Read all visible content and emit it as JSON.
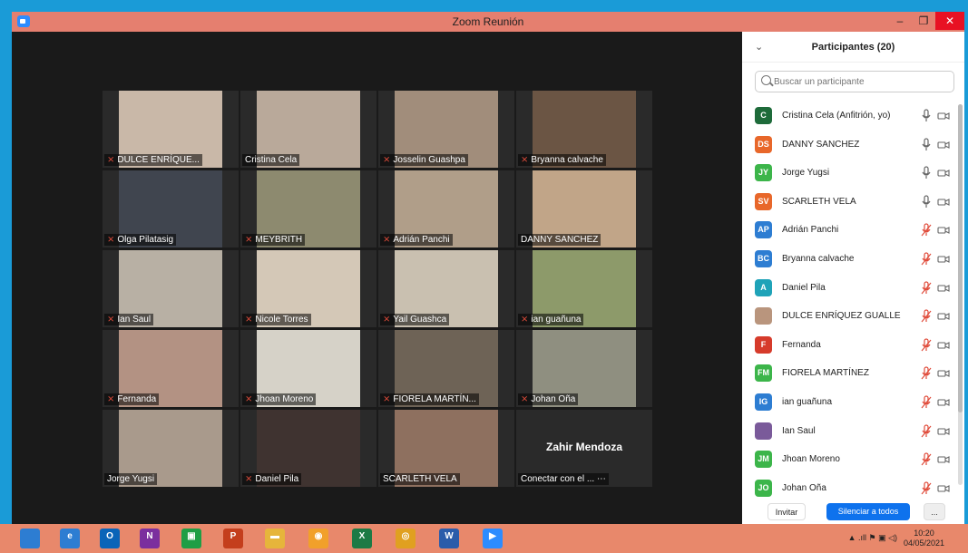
{
  "window": {
    "title": "Zoom Reunión",
    "minimize": "–",
    "maximize": "❐",
    "close": "✕"
  },
  "gallery": {
    "tiles": [
      {
        "name": "DULCE ENRÍQUE...",
        "muted": true,
        "bg": "#c9b8a8"
      },
      {
        "name": "Cristina Cela",
        "muted": false,
        "bg": "#b9a99a"
      },
      {
        "name": "Josselin Guashpa",
        "muted": true,
        "bg": "#a18d7b"
      },
      {
        "name": "Bryanna calvache",
        "muted": true,
        "bg": "#6b5544"
      },
      {
        "name": "Olga Pilatasig",
        "muted": true,
        "bg": "#40454f"
      },
      {
        "name": "MEYBRITH",
        "muted": true,
        "bg": "#8d8a6f"
      },
      {
        "name": "Adrián Panchi",
        "muted": true,
        "bg": "#b09e89"
      },
      {
        "name": "DANNY SANCHEZ",
        "muted": false,
        "bg": "#c1a588"
      },
      {
        "name": "Ian Saul",
        "muted": true,
        "bg": "#b8b0a4"
      },
      {
        "name": "Nicole     Torres",
        "muted": true,
        "bg": "#d4c8b7"
      },
      {
        "name": "Yail Guashca",
        "muted": true,
        "bg": "#c9c0b0"
      },
      {
        "name": "ian guañuna",
        "muted": true,
        "bg": "#8d9a6a"
      },
      {
        "name": "Fernanda",
        "muted": true,
        "bg": "#b39283"
      },
      {
        "name": "Jhoan Moreno",
        "muted": true,
        "bg": "#d6d2c8"
      },
      {
        "name": "FIORELA MARTÍN...",
        "muted": true,
        "bg": "#6e6356"
      },
      {
        "name": "Johan Oña",
        "muted": true,
        "bg": "#8f8f80"
      },
      {
        "name": "Jorge    Yugsi",
        "muted": false,
        "bg": "#a99a8c",
        "active": true
      },
      {
        "name": "Daniel Pila",
        "muted": true,
        "bg": "#3f3330"
      },
      {
        "name": "SCARLETH VELA",
        "muted": false,
        "bg": "#8e705f"
      },
      {
        "name": "Conectar con el ... ⋯",
        "muted": false,
        "bg": "#2a2a2a",
        "big_name": "Zahir Mendoza"
      }
    ]
  },
  "participants_panel": {
    "title": "Participantes (20)",
    "search_placeholder": "Buscar un participante",
    "items": [
      {
        "initials": "C",
        "name": "Cristina Cela (Anfitrión, yo)",
        "color": "#1e6b3a",
        "mic": "on"
      },
      {
        "initials": "DS",
        "name": "DANNY SANCHEZ",
        "color": "#e8672a",
        "mic": "on"
      },
      {
        "initials": "JY",
        "name": "Jorge    Yugsi",
        "color": "#3cb54a",
        "mic": "on"
      },
      {
        "initials": "SV",
        "name": "SCARLETH VELA",
        "color": "#e8672a",
        "mic": "on"
      },
      {
        "initials": "AP",
        "name": "Adrián Panchi",
        "color": "#2d7dd2",
        "mic": "muted"
      },
      {
        "initials": "BC",
        "name": "Bryanna calvache",
        "color": "#2d7dd2",
        "mic": "muted"
      },
      {
        "initials": "A",
        "name": "Daniel Pila",
        "color": "#1fa3b8",
        "mic": "muted"
      },
      {
        "initials": "",
        "name": "DULCE ENRÍQUEZ GUALLE",
        "color": "#b9957d",
        "mic": "muted"
      },
      {
        "initials": "F",
        "name": "Fernanda",
        "color": "#d63b2b",
        "mic": "muted"
      },
      {
        "initials": "FM",
        "name": "FIORELA MARTÍNEZ",
        "color": "#3cb54a",
        "mic": "muted"
      },
      {
        "initials": "IG",
        "name": "ian guañuna",
        "color": "#2d7dd2",
        "mic": "muted"
      },
      {
        "initials": "",
        "name": "Ian Saul",
        "color": "#7a5a9a",
        "mic": "muted"
      },
      {
        "initials": "JM",
        "name": "Jhoan Moreno",
        "color": "#3cb54a",
        "mic": "muted"
      },
      {
        "initials": "JO",
        "name": "Johan Oña",
        "color": "#3cb54a",
        "mic": "muted"
      }
    ],
    "invite_label": "Invitar",
    "mute_all_label": "Silenciar a todos",
    "more_label": "..."
  },
  "taskbar": {
    "icons": [
      {
        "name": "windows-start-icon",
        "label": "",
        "color": "#2d7dd2"
      },
      {
        "name": "edge-icon",
        "label": "e",
        "color": "#2d7dd2"
      },
      {
        "name": "outlook-icon",
        "label": "O",
        "color": "#0a64b8"
      },
      {
        "name": "onenote-icon",
        "label": "N",
        "color": "#7b2f9e"
      },
      {
        "name": "store-icon",
        "label": "▣",
        "color": "#1e9e45"
      },
      {
        "name": "powerpoint-icon",
        "label": "P",
        "color": "#c43e1c"
      },
      {
        "name": "file-explorer-icon",
        "label": "▬",
        "color": "#e6b53b"
      },
      {
        "name": "app-icon",
        "label": "◉",
        "color": "#f1a02a"
      },
      {
        "name": "excel-icon",
        "label": "X",
        "color": "#1d7a45"
      },
      {
        "name": "chrome-icon",
        "label": "◎",
        "color": "#e0a020"
      },
      {
        "name": "word-icon",
        "label": "W",
        "color": "#2b5caa"
      },
      {
        "name": "zoom-icon",
        "label": "▶",
        "color": "#2d8cff"
      }
    ],
    "tray": "▲  .ıll  ⚑  ▣  ◁)",
    "time": "10:20",
    "date": "04/05/2021"
  }
}
